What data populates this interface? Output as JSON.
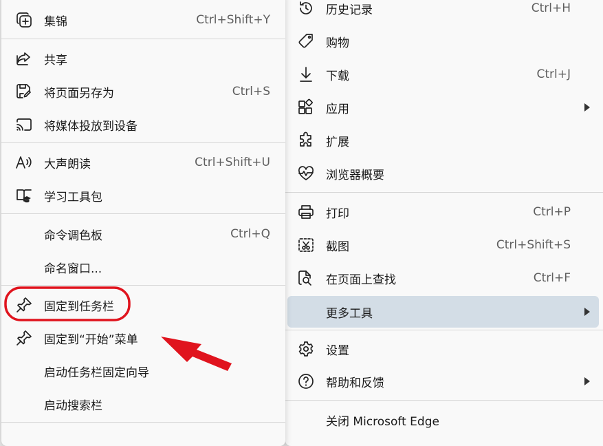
{
  "submenu": {
    "items": [
      {
        "label": "集锦",
        "shortcut": "Ctrl+Shift+Y",
        "icon": "collections-icon"
      },
      {
        "label": "共享",
        "shortcut": "",
        "icon": "share-icon"
      },
      {
        "label": "将页面另存为",
        "shortcut": "Ctrl+S",
        "icon": "save-page-icon"
      },
      {
        "label": "将媒体投放到设备",
        "shortcut": "",
        "icon": "cast-icon"
      },
      {
        "label": "大声朗读",
        "shortcut": "Ctrl+Shift+U",
        "icon": "read-aloud-icon"
      },
      {
        "label": "学习工具包",
        "shortcut": "",
        "icon": "learning-toolkit-icon"
      },
      {
        "label": "命令调色板",
        "shortcut": "Ctrl+Q",
        "icon": ""
      },
      {
        "label": "命名窗口...",
        "shortcut": "",
        "icon": ""
      },
      {
        "label": "固定到任务栏",
        "shortcut": "",
        "icon": "pin-icon"
      },
      {
        "label": "固定到“开始”菜单",
        "shortcut": "",
        "icon": "pin-icon"
      },
      {
        "label": "启动任务栏固定向导",
        "shortcut": "",
        "icon": ""
      },
      {
        "label": "启动搜索栏",
        "shortcut": "",
        "icon": ""
      }
    ]
  },
  "main_menu": {
    "items": [
      {
        "label": "历史记录",
        "shortcut": "Ctrl+H",
        "icon": "history-icon"
      },
      {
        "label": "购物",
        "shortcut": "",
        "icon": "tag-icon"
      },
      {
        "label": "下载",
        "shortcut": "Ctrl+J",
        "icon": "download-icon"
      },
      {
        "label": "应用",
        "shortcut": "",
        "icon": "apps-icon",
        "submenu": true
      },
      {
        "label": "扩展",
        "shortcut": "",
        "icon": "puzzle-icon"
      },
      {
        "label": "浏览器概要",
        "shortcut": "",
        "icon": "heartbeat-icon"
      },
      {
        "label": "打印",
        "shortcut": "Ctrl+P",
        "icon": "print-icon"
      },
      {
        "label": "截图",
        "shortcut": "Ctrl+Shift+S",
        "icon": "screenshot-icon"
      },
      {
        "label": "在页面上查找",
        "shortcut": "Ctrl+F",
        "icon": "find-icon"
      },
      {
        "label": "更多工具",
        "shortcut": "",
        "icon": "",
        "submenu": true,
        "highlighted": true
      },
      {
        "label": "设置",
        "shortcut": "",
        "icon": "gear-icon"
      },
      {
        "label": "帮助和反馈",
        "shortcut": "",
        "icon": "help-icon",
        "submenu": true
      },
      {
        "label": "关闭 Microsoft Edge",
        "shortcut": "",
        "icon": ""
      }
    ]
  },
  "annotation": {
    "color": "#e0141e"
  }
}
